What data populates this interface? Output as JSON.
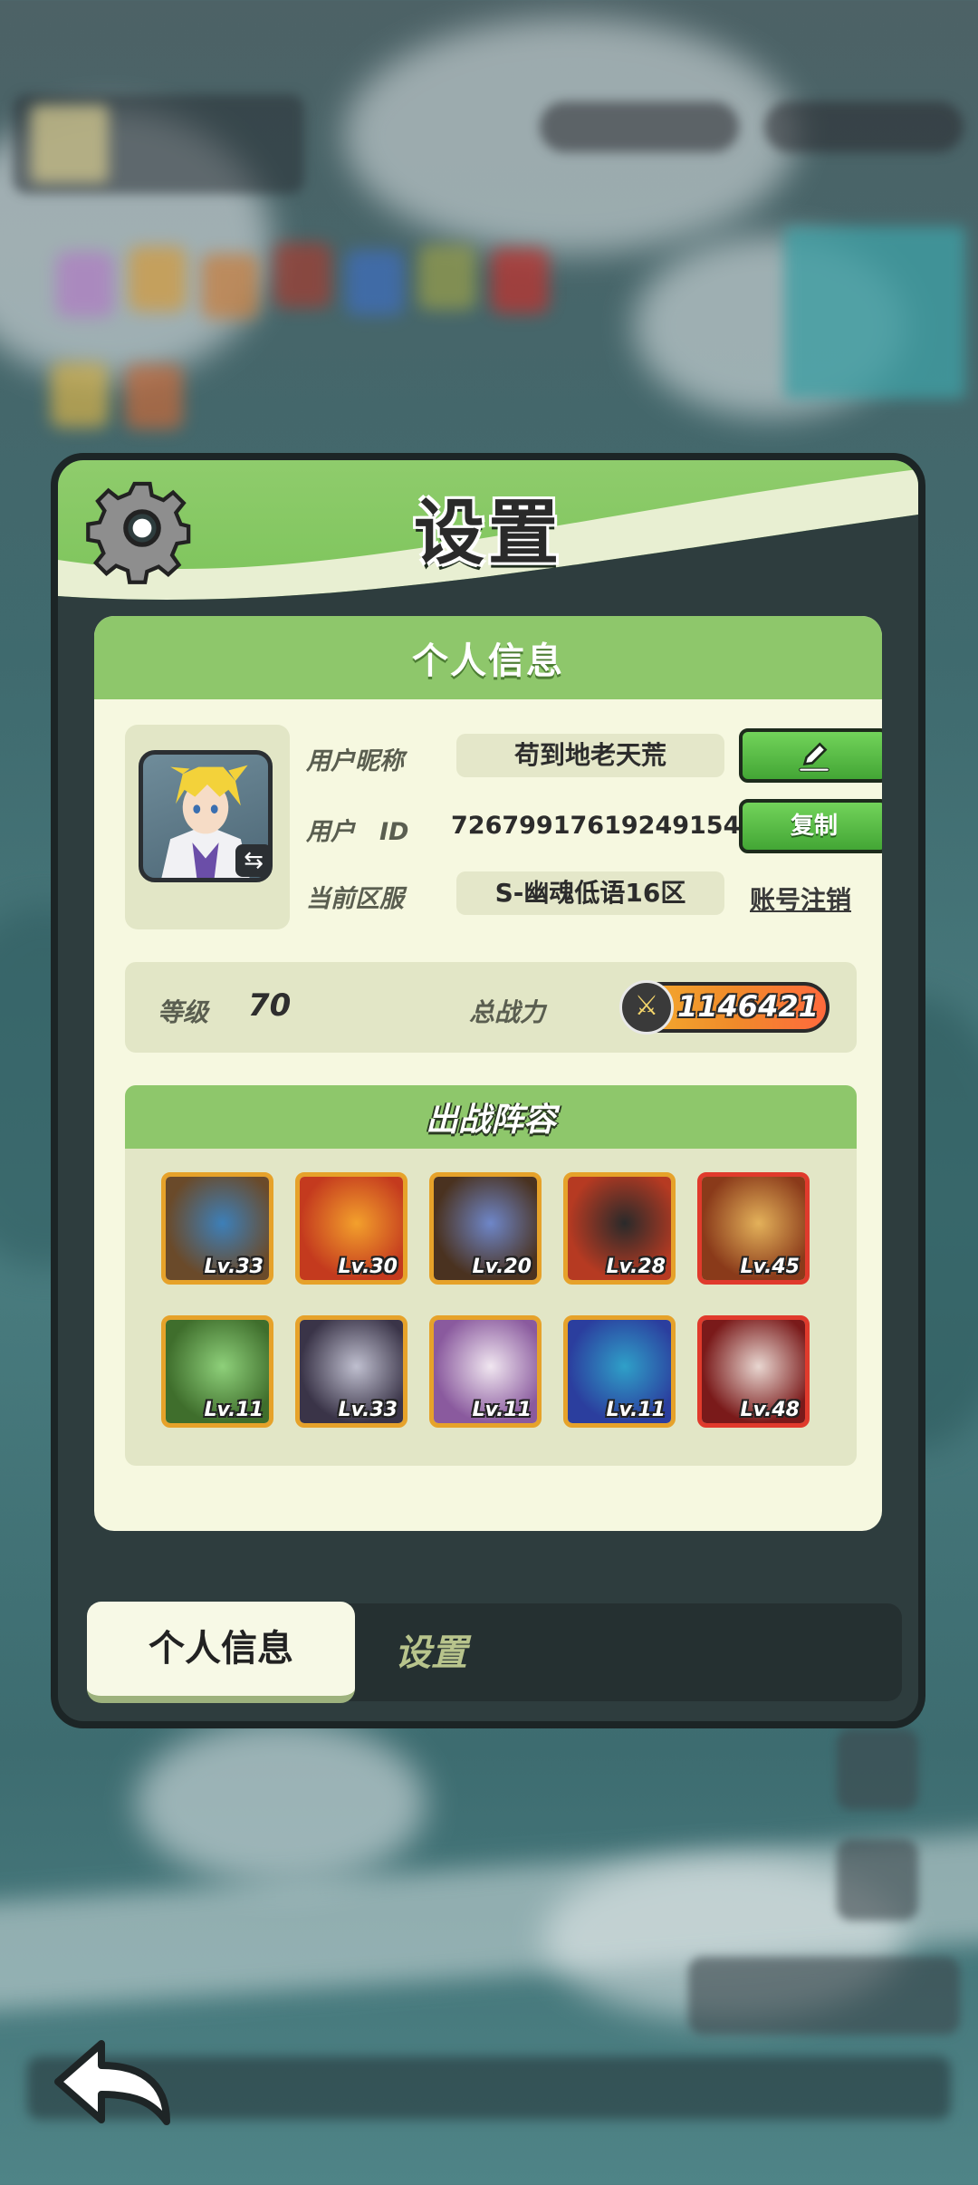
{
  "settings_panel": {
    "title": "设置",
    "profile_card": {
      "header": "个人信息",
      "nickname_label": "用户昵称",
      "nickname_value": "苟到地老天荒",
      "user_id_label": "用户　ID",
      "user_id_value": "7267991761924915​4",
      "server_label": "当前区服",
      "server_value": "S-幽魂低语16区",
      "copy_button": "复制",
      "edit_icon": "pencil-icon",
      "cancel_account_link": "账号注销",
      "level_label": "等级",
      "level_value": "70",
      "power_label": "总战力",
      "power_value": "1146421"
    },
    "lineup": {
      "header": "出战阵容",
      "heroes": [
        {
          "level": "Lv.33",
          "frame": "gold",
          "colors": [
            "#6a4a2a",
            "#3d7fb8"
          ]
        },
        {
          "level": "Lv.30",
          "frame": "gold",
          "colors": [
            "#c43a1e",
            "#f3a02c"
          ]
        },
        {
          "level": "Lv.20",
          "frame": "gold",
          "colors": [
            "#4a3220",
            "#6e86c8"
          ]
        },
        {
          "level": "Lv.28",
          "frame": "gold",
          "colors": [
            "#b63a22",
            "#2a2a2a"
          ]
        },
        {
          "level": "Lv.45",
          "frame": "red",
          "colors": [
            "#8a3a1a",
            "#e3b15a"
          ]
        },
        {
          "level": "Lv.11",
          "frame": "gold",
          "colors": [
            "#3f6e2c",
            "#8ed07a"
          ]
        },
        {
          "level": "Lv.33",
          "frame": "gold",
          "colors": [
            "#3a3448",
            "#bfbfcf"
          ]
        },
        {
          "level": "Lv.11",
          "frame": "gold",
          "colors": [
            "#8a5a9e",
            "#f0e6f0"
          ]
        },
        {
          "level": "Lv.11",
          "frame": "gold",
          "colors": [
            "#2b3e9e",
            "#2fa0c8"
          ]
        },
        {
          "level": "Lv.48",
          "frame": "red",
          "colors": [
            "#7a1a1a",
            "#e8d6d0"
          ]
        }
      ]
    },
    "tabs": {
      "active": "个人信息",
      "inactive": "设置"
    }
  }
}
